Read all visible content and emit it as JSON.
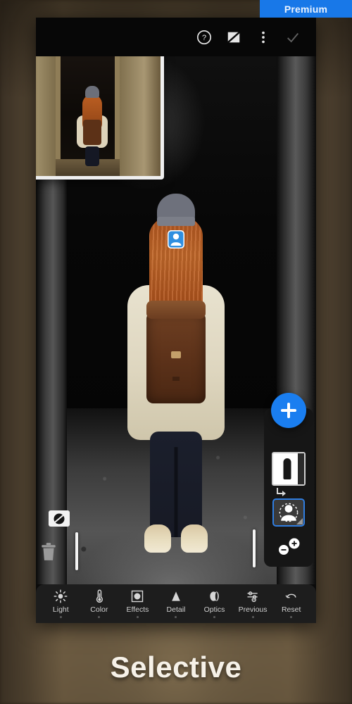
{
  "badge": {
    "label": "Premium",
    "color": "#1878e8"
  },
  "topbar": {
    "icons": [
      {
        "name": "help-icon",
        "glyph": "?"
      },
      {
        "name": "compare-original-icon",
        "glyph": "crossed-square"
      },
      {
        "name": "overflow-menu-icon",
        "glyph": "three-dots"
      },
      {
        "name": "confirm-check-icon",
        "glyph": "check"
      }
    ]
  },
  "thumbnail": {
    "name": "original-preview-thumbnail",
    "description": "Original colour photo preview"
  },
  "canvas": {
    "name": "photo-canvas",
    "description": "Selective colour edit: subject in colour, background desaturated",
    "pin": {
      "name": "subject-mask-pin",
      "color": "#2f8fe0"
    }
  },
  "left_controls": {
    "mask_visibility": {
      "label": "Show/Hide mask overlay",
      "name": "mask-visibility-toggle"
    },
    "delete": {
      "label": "Delete mask",
      "name": "delete-mask-button"
    },
    "slider_left": {
      "name": "left-edge-slider"
    },
    "slider_right": {
      "name": "right-edge-slider"
    }
  },
  "mask_panel": {
    "add_mask": {
      "label": "+",
      "name": "add-mask-button",
      "color": "#1a7ef0"
    },
    "overview": {
      "label": "Mask overview",
      "name": "mask-overview-thumbnail"
    },
    "selected_mask": {
      "label": "Select Subject",
      "name": "mask-chip-subject",
      "selected": true,
      "border_color": "#2f7de0"
    },
    "brush": {
      "label": "Add / Subtract",
      "name": "brush-add-subtract-control"
    }
  },
  "toolstrip": {
    "items": [
      {
        "label": "Light",
        "icon": "sun-icon",
        "name": "tool-light"
      },
      {
        "label": "Color",
        "icon": "thermometer-icon",
        "name": "tool-color"
      },
      {
        "label": "Effects",
        "icon": "square-dot-icon",
        "name": "tool-effects"
      },
      {
        "label": "Detail",
        "icon": "triangle-icon",
        "name": "tool-detail"
      },
      {
        "label": "Optics",
        "icon": "lens-icon",
        "name": "tool-optics"
      },
      {
        "label": "Previous",
        "icon": "sliders-icon",
        "name": "tool-previous"
      },
      {
        "label": "Reset",
        "icon": "undo-icon",
        "name": "tool-reset"
      }
    ]
  },
  "caption": {
    "text": "Selective"
  }
}
